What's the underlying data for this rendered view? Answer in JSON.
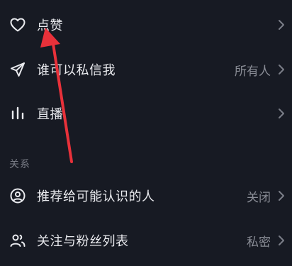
{
  "settings": {
    "rows_top": [
      {
        "label": "点赞",
        "value": "",
        "icon": "heart-icon"
      },
      {
        "label": "谁可以私信我",
        "value": "所有人",
        "icon": "send-icon"
      },
      {
        "label": "直播",
        "value": "",
        "icon": "live-bars-icon"
      }
    ],
    "section_title": "关系",
    "rows_relation": [
      {
        "label": "推荐给可能认识的人",
        "value": "关闭",
        "icon": "user-circle-icon"
      },
      {
        "label": "关注与粉丝列表",
        "value": "私密",
        "icon": "users-icon"
      }
    ]
  },
  "colors": {
    "background": "#171a23",
    "text": "#e9eaee",
    "secondary_text": "#8a8d96",
    "annotation_arrow": "#e8313a"
  }
}
